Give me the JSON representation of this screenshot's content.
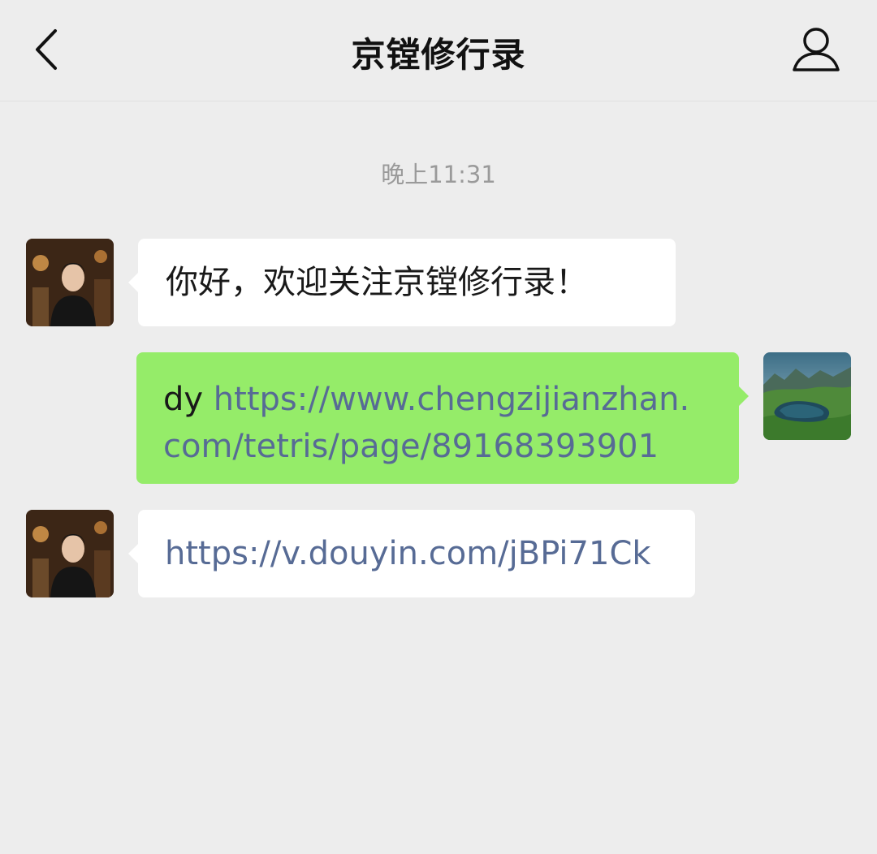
{
  "header": {
    "title": "京镗修行录",
    "back_icon": "chevron-left-icon",
    "profile_icon": "person-icon"
  },
  "chat": {
    "timestamp": "晚上11:31",
    "messages": [
      {
        "direction": "incoming",
        "avatar": "person-photo-avatar",
        "text": "你好，欢迎关注京镗修行录！"
      },
      {
        "direction": "outgoing",
        "avatar": "landscape-photo-avatar",
        "prefix": "dy ",
        "link_line1": "https://www.chengzijianzhan.",
        "link_line2": "com/tetris/page/89168393901"
      },
      {
        "direction": "incoming",
        "avatar": "person-photo-avatar",
        "link": "https://v.douyin.com/jBPi71Ck"
      }
    ]
  },
  "colors": {
    "background": "#ededed",
    "incoming_bubble": "#ffffff",
    "outgoing_bubble": "#95ec69",
    "link": "#576b95",
    "timestamp": "#9a9a9a"
  }
}
